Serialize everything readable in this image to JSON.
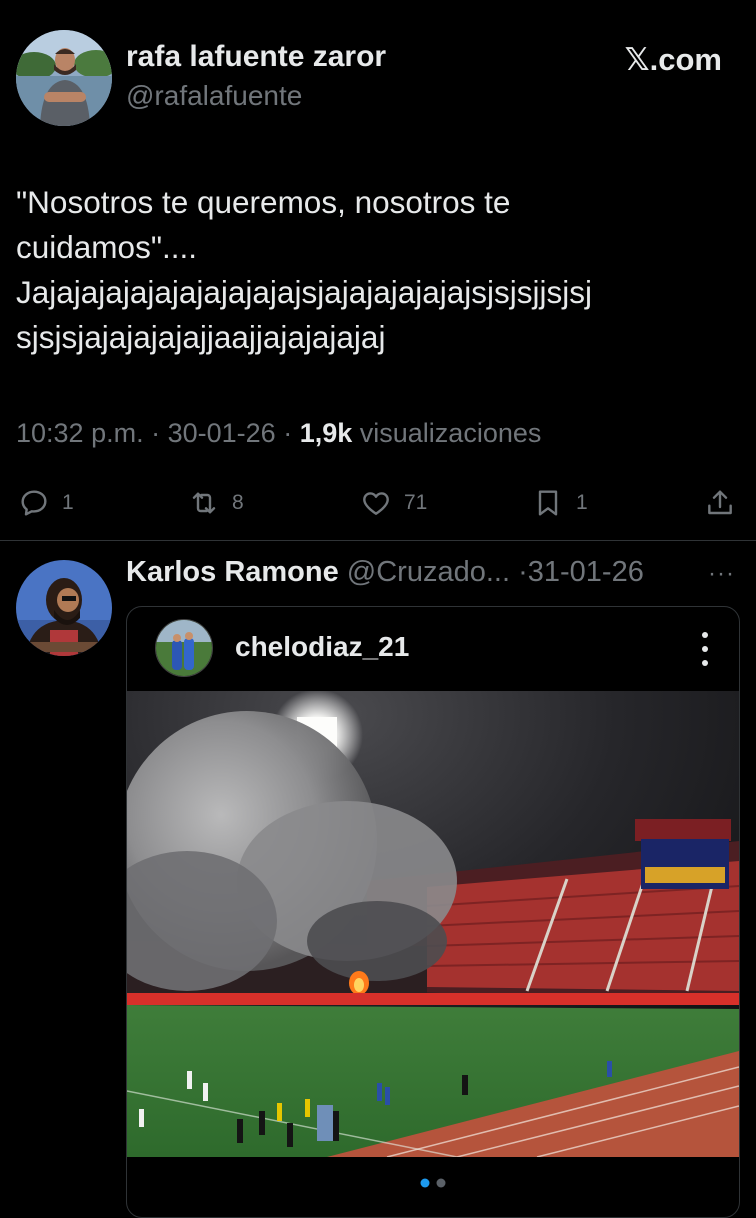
{
  "tweet": {
    "author_name": "rafa lafuente zaror",
    "author_handle": "@rafalafuente",
    "brand": "𝕏.com",
    "text_lines": [
      "\"Nosotros te queremos, nosotros te",
      "cuidamos\"....",
      "Jajajajajajajajajajajajsjajajajajajajsjsjsjjsjsj",
      "sjsjsjajajajajajjaajjajajajajaj"
    ],
    "time": "10:32 p.m.",
    "date": "30-01-26",
    "views_count": "1,9k",
    "views_label": "visualizaciones",
    "replies": "1",
    "retweets": "8",
    "likes": "71",
    "bookmarks": "1",
    "icons": {
      "reply": "reply-icon",
      "retweet": "retweet-icon",
      "like": "heart-icon",
      "bookmark": "bookmark-icon",
      "share": "share-icon"
    }
  },
  "reply": {
    "author_name": "Karlos Ramone",
    "author_handle": "@Cruzado...",
    "date": "31-01-26",
    "more": "···",
    "card": {
      "username": "chelodiaz_21",
      "carousel_total": 2,
      "carousel_active": 1
    }
  },
  "colors": {
    "background": "#000000",
    "text": "#e7e9ea",
    "muted": "#71767b",
    "divider": "#2f3336",
    "carousel_active": "#1d9bf0"
  }
}
